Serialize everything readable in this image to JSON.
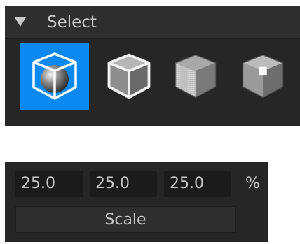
{
  "select_panel": {
    "title": "Select",
    "expanded": true,
    "modes": [
      {
        "icon": "object-select-icon",
        "active": true
      },
      {
        "icon": "edge-select-icon",
        "active": false
      },
      {
        "icon": "face-select-icon",
        "active": false
      },
      {
        "icon": "vertex-select-icon",
        "active": false
      }
    ],
    "accent_color": "#0a89f2"
  },
  "scale_panel": {
    "x_value": "25.0",
    "y_value": "25.0",
    "z_value": "25.0",
    "unit": "%",
    "button_label": "Scale"
  }
}
